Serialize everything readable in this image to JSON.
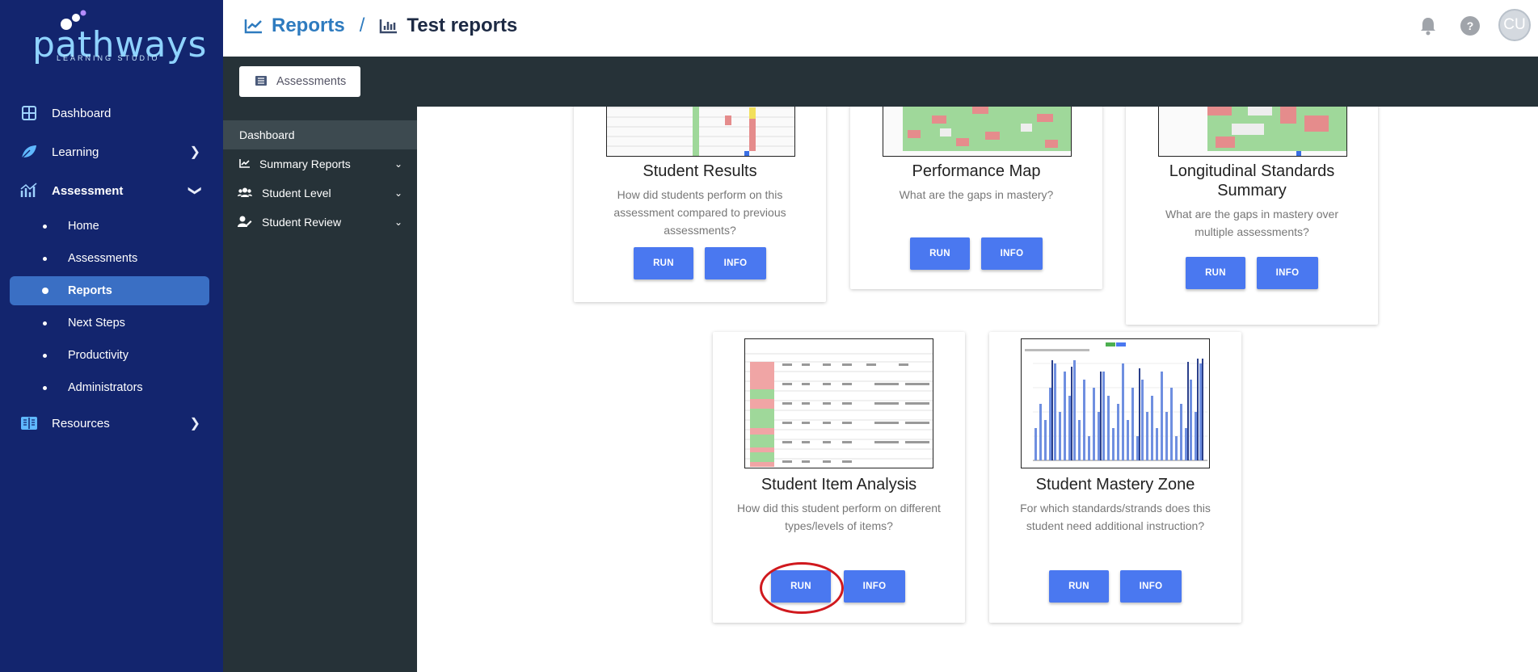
{
  "brand": {
    "name": "pathways",
    "tagline": "LEARNING STUDIO"
  },
  "nav": {
    "items": [
      {
        "label": "Dashboard",
        "icon": "dashboard-grid-icon"
      },
      {
        "label": "Learning",
        "icon": "leaf-icon"
      },
      {
        "label": "Assessment",
        "icon": "assessment-chart-icon"
      },
      {
        "label": "Resources",
        "icon": "book-icon"
      }
    ],
    "assessment_sub": [
      "Home",
      "Assessments",
      "Reports",
      "Next Steps",
      "Productivity",
      "Administrators"
    ],
    "active_sub": "Reports"
  },
  "header": {
    "crumb_root": "Reports",
    "separator": "/",
    "crumb_current": "Test reports",
    "help": "?",
    "avatar_initials": "CU"
  },
  "toolbar": {
    "assessments_label": "Assessments"
  },
  "sidebar2": {
    "dashboard": "Dashboard",
    "items": [
      "Summary Reports",
      "Student Level",
      "Student Review"
    ]
  },
  "cards": [
    {
      "title": "Student Results",
      "desc": "How did students perform on this assessment compared to previous assessments?",
      "run": "RUN",
      "info": "INFO"
    },
    {
      "title": "Performance Map",
      "desc": "What are the gaps in mastery?",
      "run": "RUN",
      "info": "INFO"
    },
    {
      "title": "Longitudinal Standards Summary",
      "desc": "What are the gaps in mastery over multiple assessments?",
      "run": "RUN",
      "info": "INFO"
    },
    {
      "title": "Student Item Analysis",
      "desc": "How did this student perform on different types/levels of items?",
      "run": "RUN",
      "info": "INFO"
    },
    {
      "title": "Student Mastery Zone",
      "desc": "For which standards/strands does this student need additional instruction?",
      "run": "RUN",
      "info": "INFO"
    }
  ],
  "colors": {
    "nav_bg": "#13256e",
    "active": "#3a6fc4",
    "button": "#4a78f0",
    "dark_band": "#263238",
    "highlight_circle": "#d0191e"
  }
}
